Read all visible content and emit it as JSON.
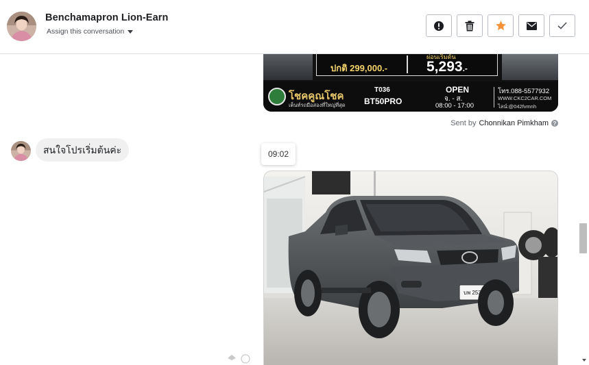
{
  "header": {
    "contact_name": "Benchamapron Lion-Earn",
    "assign_label": "Assign this conversation",
    "actions": [
      {
        "name": "mark-spam-button",
        "icon": "exclamation-icon",
        "color": "#1c1e21"
      },
      {
        "name": "delete-button",
        "icon": "trash-icon",
        "color": "#1c1e21"
      },
      {
        "name": "star-button",
        "icon": "star-icon",
        "color": "#f7923a"
      },
      {
        "name": "mark-unread-button",
        "icon": "envelope-icon",
        "color": "#1c1e21"
      },
      {
        "name": "mark-done-button",
        "icon": "checkmark-icon",
        "color": "#4b4f56"
      }
    ]
  },
  "banner": {
    "price_normal": "ปกติ 299,000.-",
    "monthly_label": "ผ่อนเริ่มต้น",
    "monthly_value": "5,293",
    "monthly_suffix": ".-",
    "brand": "โชคคูณโชค",
    "tagline": "เต็นท์รถมือสองที่ใหญ่ที่สุด",
    "stock_code": "T036",
    "model": "BT50PRO",
    "open_label": "OPEN",
    "days": "จ. - ส.",
    "hours": "08:00 - 17:00",
    "phone": "โทร.088-5577932",
    "website": "WWW.CKC2CAR.COM",
    "line_id": "ไลน์:@042fvmnh"
  },
  "sent_by": {
    "prefix": "Sent by",
    "agent": "Chonnikan Pimkham"
  },
  "messages": {
    "incoming_text": "สนใจโปรเริ่มต้นค่ะ",
    "timestamp": "09:02"
  },
  "car_photo": {
    "plate": "บพ 2538"
  }
}
